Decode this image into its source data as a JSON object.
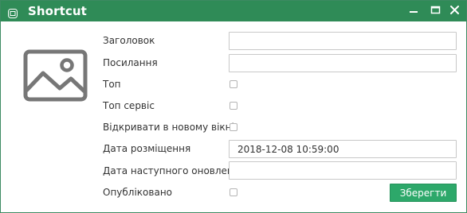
{
  "window": {
    "title": "Shortcut",
    "accent_color": "#2f8b57"
  },
  "icons": {
    "title": "window-app-icon",
    "minimize": "minimize-icon",
    "maximize": "maximize-icon",
    "close": "close-icon",
    "placeholder": "image-placeholder-icon"
  },
  "form": {
    "title_label": "Заголовок",
    "title_value": "",
    "link_label": "Посилання",
    "link_value": "",
    "top_label": "Топ",
    "top_checked": false,
    "top_service_label": "Топ сервіс",
    "top_service_checked": false,
    "new_window_label": "Відкривати в новому вікні",
    "new_window_checked": false,
    "placement_date_label": "Дата розміщення",
    "placement_date_value": "2018-12-08 10:59:00",
    "next_update_label": "Дата наступного оновлення",
    "next_update_value": "",
    "published_label": "Опубліковано",
    "published_checked": false,
    "save_label": "Зберегти",
    "save_color": "#2da86a"
  }
}
